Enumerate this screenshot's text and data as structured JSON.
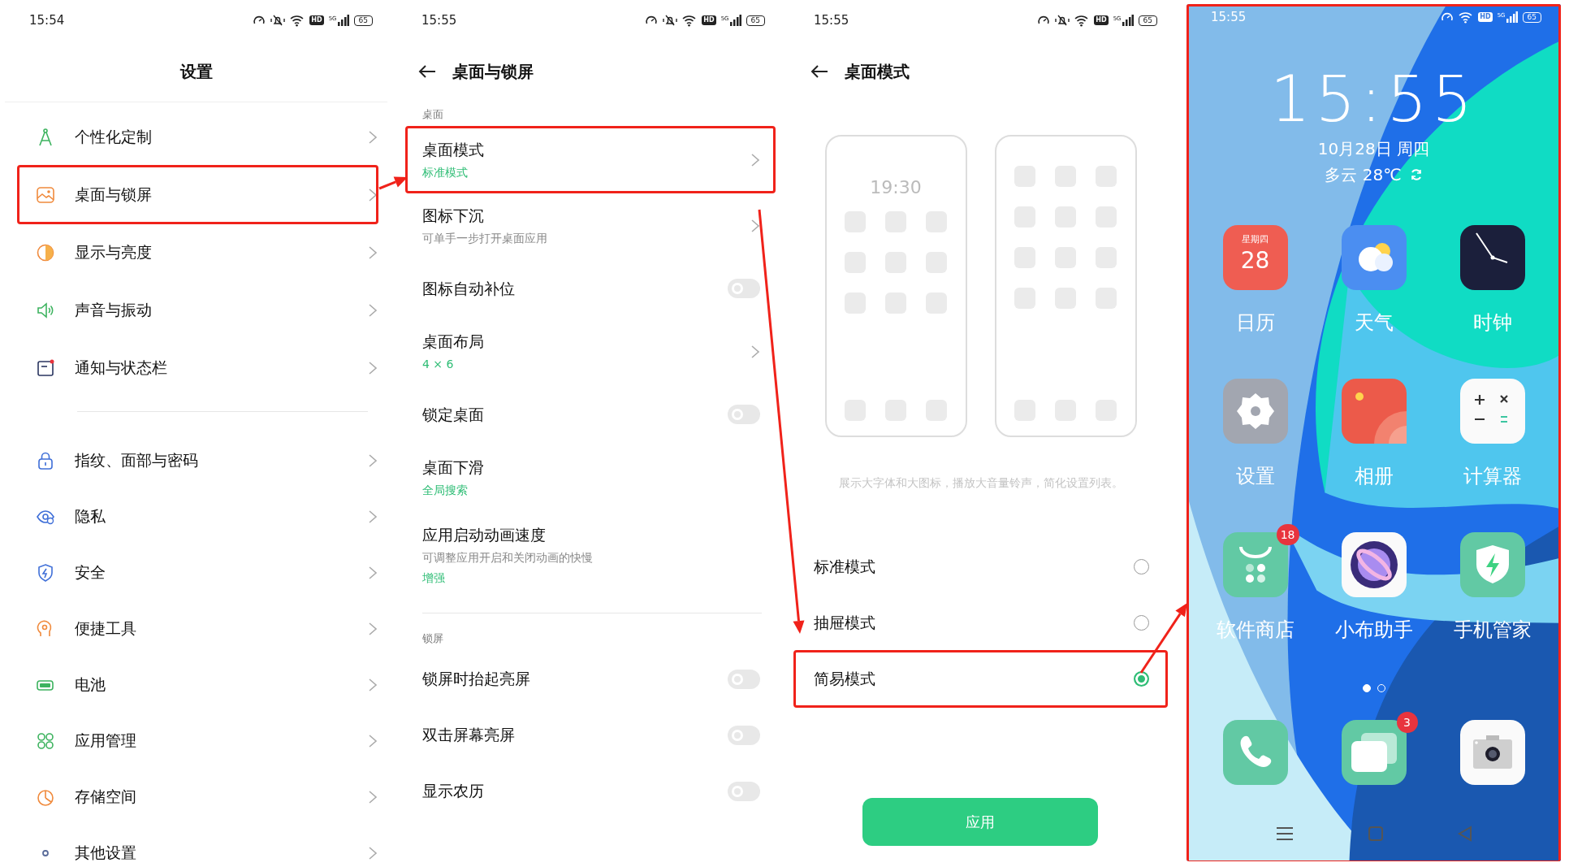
{
  "settings_screen": {
    "status_bar": {
      "time": "15:54",
      "muted": true,
      "hd_label": "HD",
      "network_label": "5G",
      "battery": "65"
    },
    "title": "设置",
    "groups": [
      {
        "items": [
          {
            "label": "个性化定制",
            "highlighted": false
          },
          {
            "label": "桌面与锁屏",
            "highlighted": true
          },
          {
            "label": "显示与亮度",
            "highlighted": false
          },
          {
            "label": "声音与振动",
            "highlighted": false
          },
          {
            "label": "通知与状态栏",
            "highlighted": false
          }
        ]
      },
      {
        "items": [
          {
            "label": "指纹、面部与密码",
            "highlighted": false
          },
          {
            "label": "隐私",
            "highlighted": false
          },
          {
            "label": "安全",
            "highlighted": false
          },
          {
            "label": "便捷工具",
            "highlighted": false
          },
          {
            "label": "电池",
            "highlighted": false
          },
          {
            "label": "应用管理",
            "highlighted": false
          },
          {
            "label": "存储空间",
            "highlighted": false
          },
          {
            "label": "其他设置",
            "highlighted": false
          }
        ]
      }
    ]
  },
  "desktop_screen": {
    "status_bar": {
      "time": "15:55",
      "muted": true,
      "hd_label": "HD",
      "network_label": "5G",
      "battery": "65"
    },
    "title": "桌面与锁屏",
    "sections": [
      {
        "title": "桌面",
        "items": [
          {
            "kind": "link",
            "label": "桌面模式",
            "value": "标准模式",
            "highlighted": true
          },
          {
            "kind": "link",
            "label": "图标下沉",
            "description": "可单手一步打开桌面应用",
            "highlighted": false
          },
          {
            "kind": "toggle",
            "label": "图标自动补位",
            "on": false,
            "highlighted": false
          },
          {
            "kind": "link",
            "label": "桌面布局",
            "value": "4 × 6",
            "highlighted": false
          },
          {
            "kind": "toggle",
            "label": "锁定桌面",
            "on": false,
            "highlighted": false
          },
          {
            "kind": "plain",
            "label": "桌面下滑",
            "value": "全局搜索",
            "highlighted": false
          },
          {
            "kind": "plain",
            "label": "应用启动动画速度",
            "description": "可调整应用开启和关闭动画的快慢",
            "value": "增强",
            "highlighted": false
          }
        ]
      },
      {
        "title": "锁屏",
        "items": [
          {
            "kind": "toggle",
            "label": "锁屏时抬起亮屏",
            "on": false,
            "highlighted": false
          },
          {
            "kind": "toggle",
            "label": "双击屏幕亮屏",
            "on": false,
            "highlighted": false
          },
          {
            "kind": "toggle",
            "label": "显示农历",
            "on": false,
            "highlighted": false
          }
        ]
      }
    ]
  },
  "mode_screen": {
    "status_bar": {
      "time": "15:55",
      "muted": true,
      "hd_label": "HD",
      "network_label": "5G",
      "battery": "65"
    },
    "title": "桌面模式",
    "preview": {
      "clock": "19:30"
    },
    "caption": "展示大字体和大图标，播放大音量铃声，简化设置列表。",
    "options": [
      {
        "label": "标准模式",
        "selected": false,
        "highlighted": false
      },
      {
        "label": "抽屉模式",
        "selected": false,
        "highlighted": false
      },
      {
        "label": "简易模式",
        "selected": true,
        "highlighted": true
      }
    ],
    "apply_button": "应用"
  },
  "home_screen": {
    "highlighted": true,
    "status_bar": {
      "time": "15:55",
      "muted": false,
      "hd_label": "HD",
      "network_label": "5G",
      "battery": "65"
    },
    "clock": "15:55",
    "date": "10月28日 周四",
    "weather": "多云 28℃",
    "apps": [
      {
        "kind": "calendar",
        "label": "日历",
        "weekday": "星期四",
        "day": "28"
      },
      {
        "kind": "weather",
        "label": "天气"
      },
      {
        "kind": "clock",
        "label": "时钟"
      },
      {
        "kind": "settings",
        "label": "设置"
      },
      {
        "kind": "gallery",
        "label": "相册"
      },
      {
        "kind": "calculator",
        "label": "计算器"
      },
      {
        "kind": "store",
        "label": "软件商店",
        "badge": "18"
      },
      {
        "kind": "assistant",
        "label": "小布助手"
      },
      {
        "kind": "security",
        "label": "手机管家"
      }
    ],
    "page_dots": [
      {
        "selected": true
      },
      {
        "selected": false
      }
    ],
    "dock": [
      {
        "kind": "phone"
      },
      {
        "kind": "messages",
        "badge": "3"
      },
      {
        "kind": "camera"
      }
    ]
  }
}
